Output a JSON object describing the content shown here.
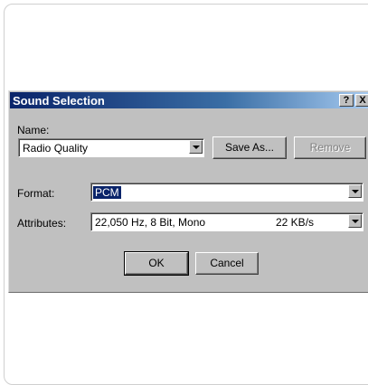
{
  "dialog": {
    "title": "Sound Selection",
    "help_glyph": "?",
    "close_glyph": "X"
  },
  "name_section": {
    "label": "Name:",
    "value": "Radio Quality",
    "save_as_label": "Save As...",
    "remove_label": "Remove"
  },
  "format_section": {
    "label": "Format:",
    "value": "PCM"
  },
  "attributes_section": {
    "label": "Attributes:",
    "value": "22,050 Hz, 8 Bit, Mono",
    "rate": "22 KB/s"
  },
  "buttons": {
    "ok_label": "OK",
    "cancel_label": "Cancel"
  },
  "colors": {
    "titlebar_start": "#0a246a",
    "titlebar_end": "#a6caf0",
    "dialog_face": "#c0c0c0",
    "selection": "#0a246a"
  }
}
